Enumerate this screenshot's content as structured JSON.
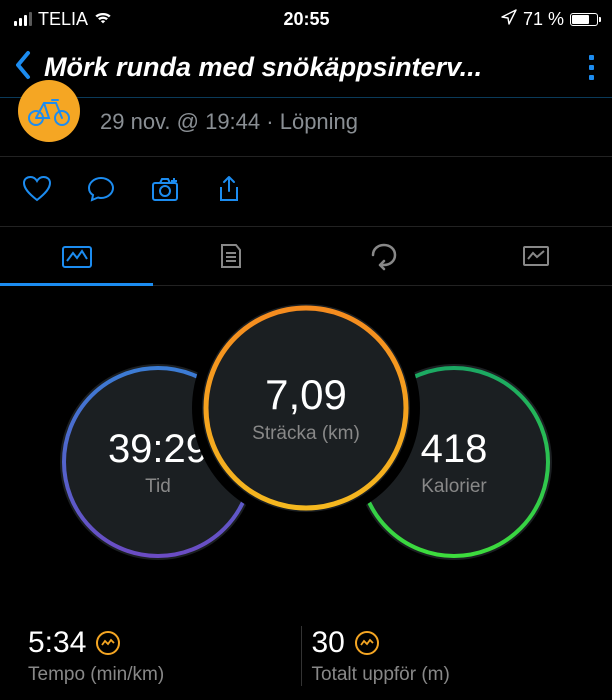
{
  "status": {
    "carrier": "TELIA",
    "time": "20:55",
    "battery_pct": "71 %",
    "battery_fill_pct": 71
  },
  "header": {
    "title": "Mörk runda med snökäppsinterv..."
  },
  "meta": {
    "datetime": "29 nov. @ 19:44",
    "separator": " · ",
    "activity": "Löpning"
  },
  "circles": {
    "distance": {
      "value": "7,09",
      "label": "Sträcka (km)"
    },
    "time": {
      "value": "39:29",
      "label": "Tid"
    },
    "calories": {
      "value": "418",
      "label": "Kalorier"
    }
  },
  "stats": {
    "pace": {
      "value": "5:34",
      "label": "Tempo (min/km)"
    },
    "ascent": {
      "value": "30",
      "label": "Totalt uppför (m)"
    }
  }
}
